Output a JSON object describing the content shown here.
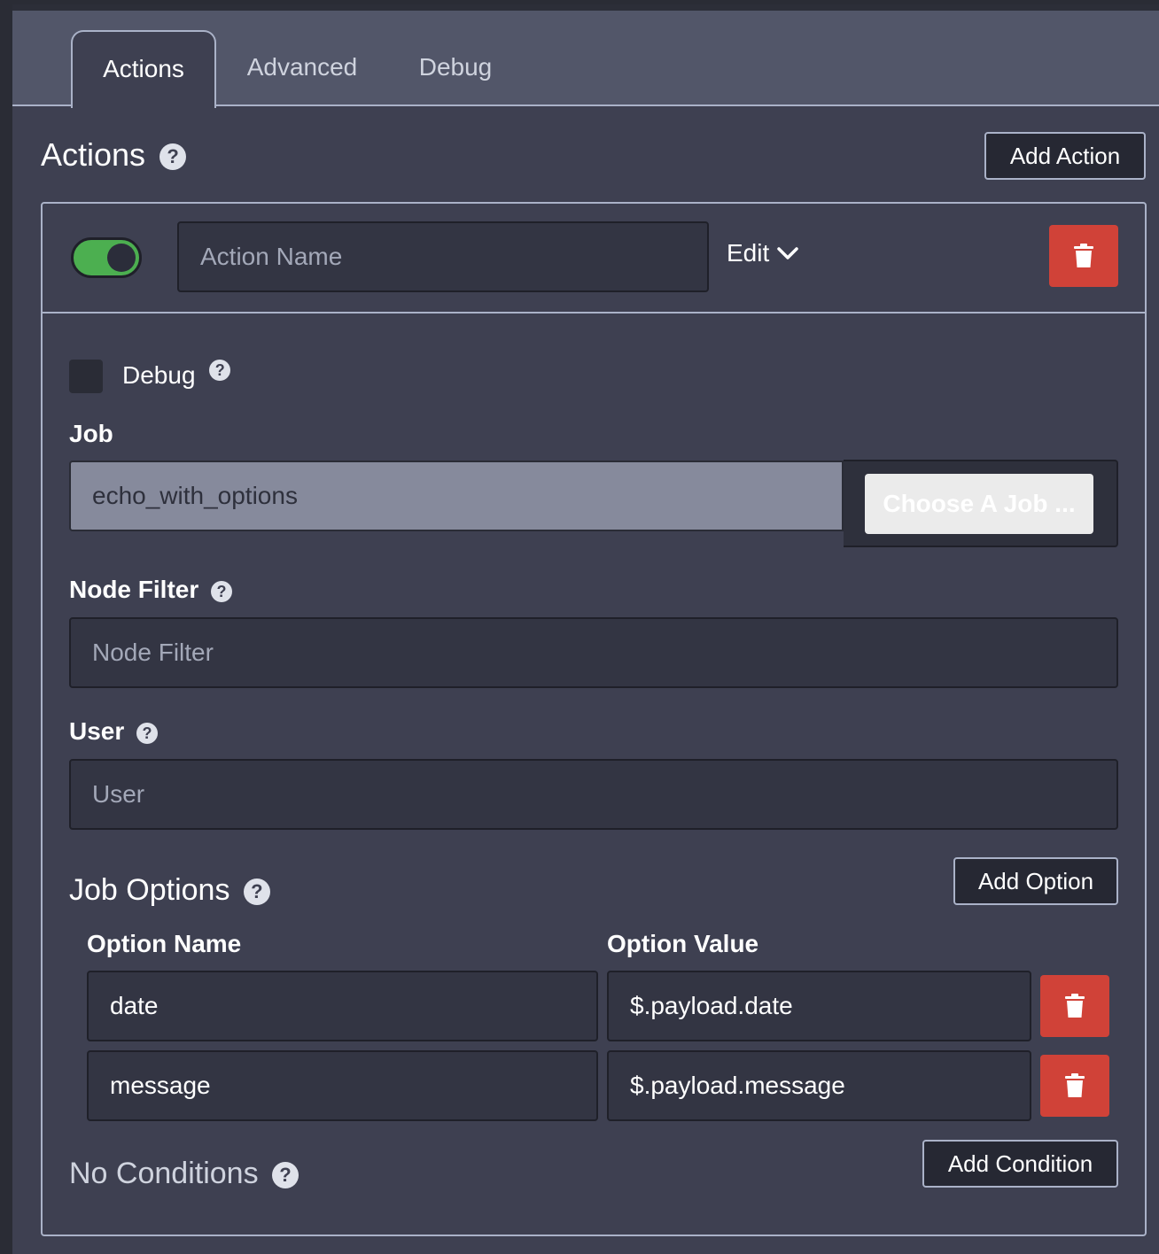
{
  "tabs": [
    {
      "label": "Actions",
      "active": true
    },
    {
      "label": "Advanced",
      "active": false
    },
    {
      "label": "Debug",
      "active": false
    }
  ],
  "header": {
    "title": "Actions",
    "add_action_label": "Add Action"
  },
  "action": {
    "enabled": true,
    "name_placeholder": "Action Name",
    "edit_label": "Edit",
    "debug_label": "Debug",
    "debug_checked": false,
    "job_label": "Job",
    "job_value": "echo_with_options",
    "choose_job_label": "Choose A Job ...",
    "node_filter_label": "Node Filter",
    "node_filter_placeholder": "Node Filter",
    "user_label": "User",
    "user_placeholder": "User"
  },
  "job_options": {
    "title": "Job Options",
    "add_option_label": "Add Option",
    "name_header": "Option Name",
    "value_header": "Option Value",
    "rows": [
      {
        "name": "date",
        "value": "$.payload.date"
      },
      {
        "name": "message",
        "value": "$.payload.message"
      }
    ]
  },
  "conditions": {
    "title": "No Conditions",
    "add_condition_label": "Add Condition"
  },
  "colors": {
    "toggle_on": "#4caf50",
    "danger": "#d04238"
  }
}
